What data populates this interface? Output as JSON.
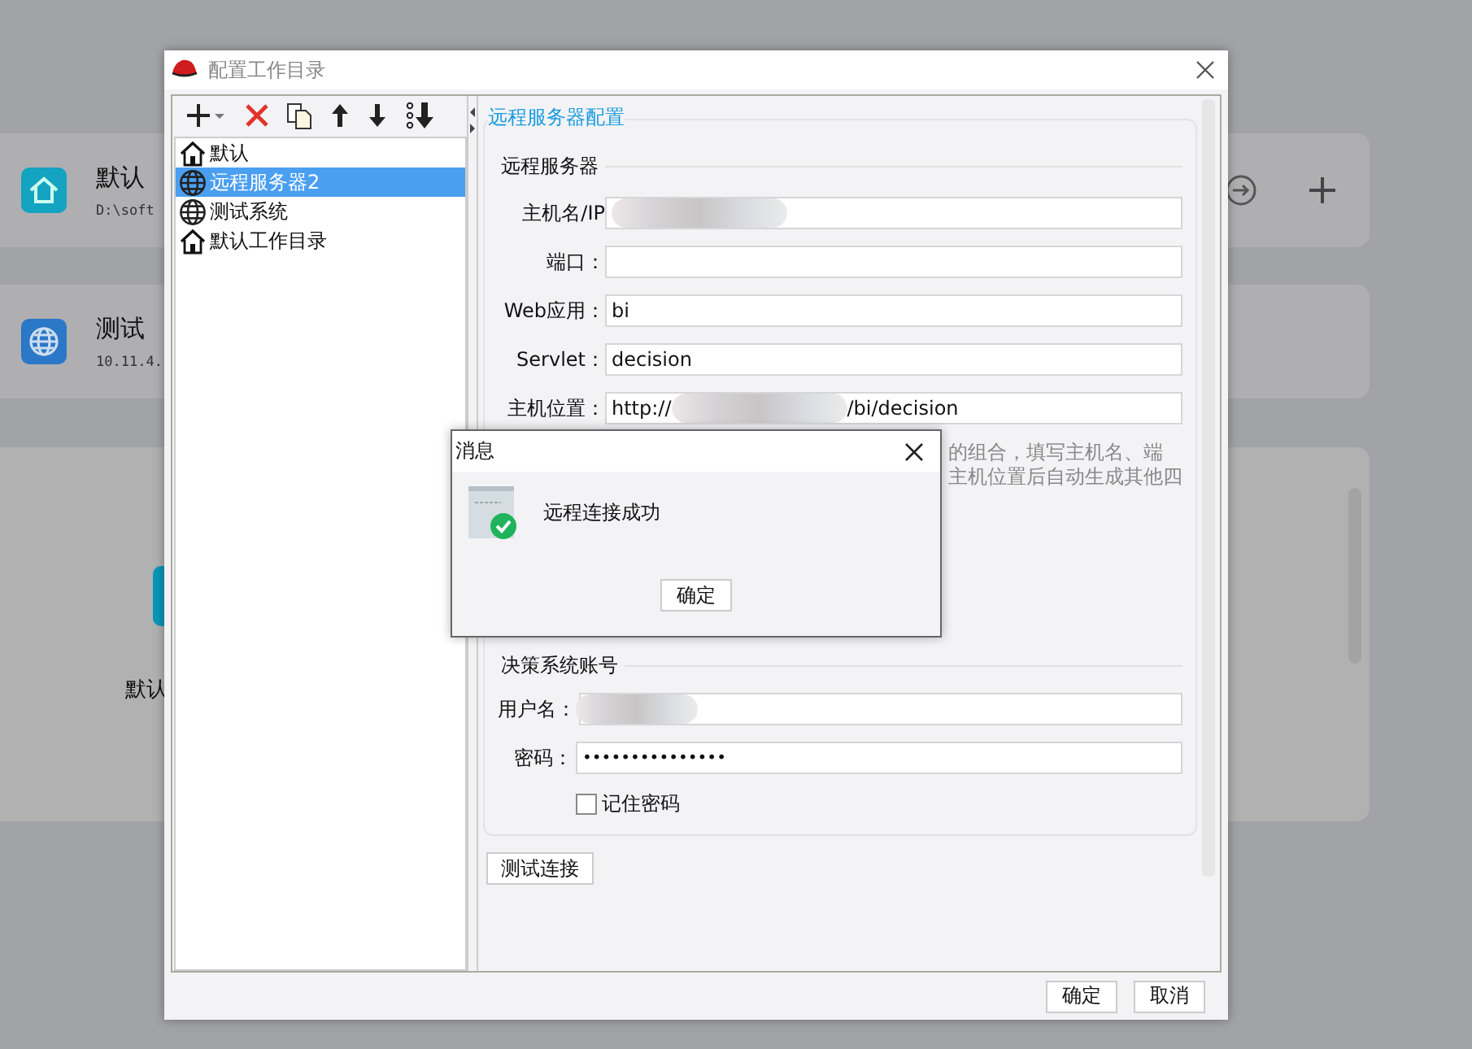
{
  "background": {
    "cards": [
      {
        "kind": "house",
        "color": "#14a3c0",
        "name": "默认",
        "path": "D:\\soft"
      },
      {
        "kind": "globe",
        "color": "#2b77c8",
        "name": "测试",
        "path": "10.11.4."
      }
    ],
    "panel": {
      "label": "默认"
    }
  },
  "dialog": {
    "title": "配置工作目录",
    "tree": [
      {
        "label": "默认",
        "kind": "house",
        "selected": false
      },
      {
        "label": "远程服务器2",
        "kind": "globe",
        "selected": true
      },
      {
        "label": "测试系统",
        "kind": "globe",
        "selected": false
      },
      {
        "label": "默认工作目录",
        "kind": "house",
        "selected": false
      }
    ],
    "config": {
      "title": "远程服务器配置",
      "server_section": "远程服务器",
      "fields": [
        {
          "label": "主机名/IP",
          "redacted": true
        },
        {
          "label": "端口："
        },
        {
          "label": "Web应用：",
          "value": "bi"
        },
        {
          "label": "Servlet：",
          "value": "decision"
        },
        {
          "label": "主机位置：",
          "value": "http://",
          "value_end": "/bi/decision",
          "redacted": true
        }
      ],
      "hint": [
        "的组合，填写主机名、端",
        "主机位置后自动生成其他四"
      ],
      "account_section": "决策系统账号",
      "username": {
        "label": "用户名：",
        "redacted": true
      },
      "password": {
        "label": "密码：",
        "value": "•••••••••••••••"
      },
      "remember": {
        "label": "记住密码",
        "checked": false
      },
      "test_button": "测试连接"
    },
    "buttons": [
      "确定",
      "取消"
    ]
  },
  "message": {
    "title": "消息",
    "text": "远程连接成功",
    "button": "确定"
  }
}
